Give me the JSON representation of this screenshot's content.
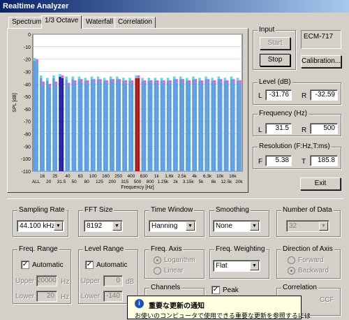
{
  "window": {
    "title": "Realtime Analyzer"
  },
  "tabs": [
    "Spectrum",
    "1/3 Octave",
    "Waterfall",
    "Correlation"
  ],
  "chart_data": {
    "type": "bar",
    "ylabel": "SPL [dB]",
    "xlabel": "Frequency  [Hz]",
    "ylim": [
      -110,
      0
    ],
    "yticks": [
      "0",
      "-10",
      "-20",
      "-30",
      "-40",
      "-50",
      "-60",
      "-70",
      "-80",
      "-90",
      "-100",
      "-110"
    ],
    "xlabels_top": [
      "16",
      "25",
      "40",
      "63",
      "100",
      "160",
      "250",
      "400",
      "630",
      "1k",
      "1.6k",
      "2.5k",
      "4k",
      "6.3k",
      "10k",
      "16k"
    ],
    "xlabels_bottom": [
      "ALL",
      "20",
      "31.5",
      "50",
      "80",
      "125",
      "200",
      "315",
      "500",
      "800",
      "1.25k",
      "2k",
      "3.15k",
      "5k",
      "8k",
      "12.5k",
      "20k"
    ],
    "categories": [
      "ALL",
      "16",
      "20",
      "25",
      "31.5",
      "40",
      "50",
      "63",
      "80",
      "100",
      "125",
      "160",
      "200",
      "250",
      "315",
      "400",
      "500",
      "630",
      "800",
      "1k",
      "1.25k",
      "1.6k",
      "2k",
      "2.5k",
      "3.15k",
      "4k",
      "5k",
      "6.3k",
      "8k",
      "10k",
      "12.5k",
      "16k",
      "20k"
    ],
    "series": [
      {
        "values": [
          -19,
          -33,
          -35,
          -33,
          -32,
          -34,
          -34,
          -34,
          -35,
          -34,
          -34,
          -35,
          -34,
          -34,
          -35,
          -35,
          -33,
          -35,
          -35,
          -35,
          -35,
          -35,
          -34,
          -34,
          -35,
          -34,
          -35,
          -34,
          -35,
          -34,
          -35,
          -34,
          -35
        ]
      },
      {
        "values": [
          -20,
          -38,
          -40,
          -38,
          -33,
          -39,
          -37,
          -36,
          -37,
          -36,
          -36,
          -37,
          -36,
          -36,
          -37,
          -37,
          -33,
          -37,
          -37,
          -37,
          -37,
          -37,
          -36,
          -36,
          -37,
          -36,
          -37,
          -36,
          -37,
          -36,
          -37,
          -36,
          -37
        ]
      }
    ],
    "colors": {
      "L": "#5ad6e8",
      "R": "#e060e0",
      "bg": "#ffffff",
      "fill": "#5d9fe0",
      "cursorL": "#2020a0",
      "cursorR": "#b01818"
    },
    "cursor_L_index": 4,
    "cursor_R_index": 16
  },
  "input": {
    "label": "Input",
    "start": "Start",
    "stop": "Stop",
    "device": "ECM-717",
    "calibration": "Calibration..."
  },
  "level": {
    "label": "Level (dB)",
    "L_label": "L",
    "L": "-31.76",
    "R_label": "R",
    "R": "-32.59"
  },
  "frequency": {
    "label": "Frequency (Hz)",
    "L_label": "L",
    "L": "31.5",
    "R_label": "R",
    "R": "500"
  },
  "resolution": {
    "label": "Resolution (F:Hz,T:ms)",
    "F_label": "F",
    "F": "5.38",
    "T_label": "T",
    "T": "185.8"
  },
  "exit": "Exit",
  "sampling": {
    "label": "Sampling Rate",
    "value": "44.100 kHz"
  },
  "fft": {
    "label": "FFT Size",
    "value": "8192"
  },
  "window_fn": {
    "label": "Time Window",
    "value": "Hanning"
  },
  "smoothing": {
    "label": "Smoothing",
    "value": "None"
  },
  "ndata": {
    "label": "Number of Data",
    "value": "32"
  },
  "freq_range": {
    "label": "Freq. Range",
    "auto": "Automatic",
    "upper_label": "Upper",
    "upper": "20000",
    "upper_unit": "Hz",
    "lower_label": "Lower",
    "lower": "20",
    "lower_unit": "Hz"
  },
  "level_range": {
    "label": "Level Range",
    "auto": "Automatic",
    "upper_label": "Upper",
    "upper": "0",
    "upper_unit": "dB",
    "lower_label": "Lower",
    "lower": "-140"
  },
  "freq_axis": {
    "label": "Freq. Axis",
    "log": "Logarithm",
    "lin": "Linear"
  },
  "weighting": {
    "label": "Freq. Weighting",
    "value": "Flat"
  },
  "direction": {
    "label": "Direction of Axis",
    "fwd": "Forward",
    "bwd": "Backward"
  },
  "channels": {
    "label": "Channels"
  },
  "peak": {
    "label": "Peak"
  },
  "correlation": {
    "label": "Correlation",
    "ccf": "CCF"
  },
  "notice": {
    "title": "重要な更新の通知",
    "body": "お使いのコンピュータで使用できる重要な更新を参照するには"
  }
}
